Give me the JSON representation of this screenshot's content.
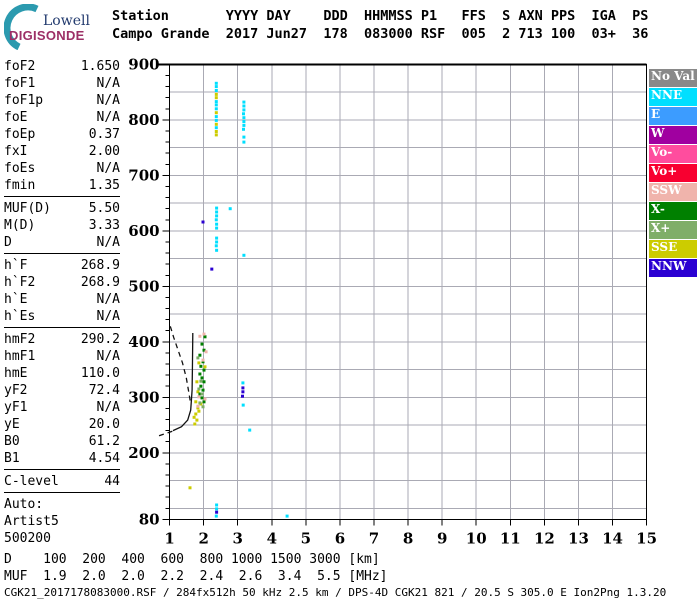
{
  "logo": {
    "line1": "Lowell",
    "line2": "DIGISONDE",
    "arc_color": "#2B9AAF",
    "line1_color": "#223A6E",
    "line2_color": "#9C2F66"
  },
  "header": {
    "row1": "Station       YYYY DAY    DDD  HHMMSS P1   FFS  S AXN PPS  IGA  PS",
    "row2": "Campo Grande  2017 Jun27  178  083000 RSF  005  2 713 100  03+  36"
  },
  "params": {
    "groups": [
      {
        "rows": [
          {
            "label": "foF2",
            "value": "1.650"
          },
          {
            "label": "foF1",
            "value": "N/A"
          },
          {
            "label": "foF1p",
            "value": "N/A"
          },
          {
            "label": "foE",
            "value": "N/A"
          },
          {
            "label": "foEp",
            "value": "0.37"
          },
          {
            "label": "fxI",
            "value": "2.00"
          },
          {
            "label": "foEs",
            "value": "N/A"
          },
          {
            "label": "fmin",
            "value": "1.35"
          }
        ],
        "rule": true
      },
      {
        "rows": [
          {
            "label": "MUF(D)",
            "value": "5.50"
          },
          {
            "label": "M(D)",
            "value": "3.33"
          },
          {
            "label": "D",
            "value": "N/A"
          }
        ],
        "rule": true
      },
      {
        "rows": [
          {
            "label": "h`F",
            "value": "268.9"
          },
          {
            "label": "h`F2",
            "value": "268.9"
          },
          {
            "label": "h`E",
            "value": "N/A"
          },
          {
            "label": "h`Es",
            "value": "N/A"
          }
        ],
        "rule": true
      },
      {
        "rows": [
          {
            "label": "hmF2",
            "value": "290.2"
          },
          {
            "label": "hmF1",
            "value": "N/A"
          },
          {
            "label": "hmE",
            "value": "110.0"
          },
          {
            "label": "yF2",
            "value": "72.4"
          },
          {
            "label": "yF1",
            "value": "N/A"
          },
          {
            "label": "yE",
            "value": "20.0"
          },
          {
            "label": "B0",
            "value": "61.2"
          },
          {
            "label": "B1",
            "value": "4.54"
          }
        ],
        "rule": true
      },
      {
        "rows": [
          {
            "label": "C-level",
            "value": "44"
          }
        ],
        "rule": true
      }
    ],
    "extra": [
      "Auto:",
      "Artist5",
      "500200"
    ]
  },
  "legend": {
    "items": [
      {
        "label": "No Val",
        "color": "#898989"
      },
      {
        "label": "NNE",
        "color": "#00DFFF"
      },
      {
        "label": "E",
        "color": "#3C9CFF"
      },
      {
        "label": "W",
        "color": "#A000A0"
      },
      {
        "label": "Vo-",
        "color": "#FF4D9E"
      },
      {
        "label": "Vo+",
        "color": "#F80030"
      },
      {
        "label": "SSW",
        "color": "#F0B4AC"
      },
      {
        "label": "X-",
        "color": "#008000"
      },
      {
        "label": "X+",
        "color": "#7FAE68"
      },
      {
        "label": "SSE",
        "color": "#CCCC00"
      },
      {
        "label": "NNW",
        "color": "#2A00D2"
      }
    ]
  },
  "chart_data": {
    "type": "scatter",
    "title": "Ionogram: virtual height (km) vs frequency (MHz)",
    "xlabel": "MHz",
    "ylabel": "km",
    "xlim": [
      1,
      15
    ],
    "ylim": [
      80,
      900
    ],
    "x_ticks": [
      1,
      2,
      3,
      4,
      5,
      6,
      7,
      8,
      9,
      10,
      11,
      12,
      13,
      14,
      15
    ],
    "y_tick_labels": [
      900,
      800,
      700,
      600,
      500,
      400,
      300,
      200,
      80
    ],
    "grid": {
      "x_step_mhz": 1,
      "y_step_km": 50,
      "color": "#AAAAB4"
    },
    "series": [
      {
        "name": "NNE",
        "color": "#00DFFF",
        "points": [
          [
            2.37,
            866
          ],
          [
            2.37,
            860
          ],
          [
            2.37,
            853
          ],
          [
            2.37,
            833
          ],
          [
            2.37,
            827
          ],
          [
            2.37,
            820
          ],
          [
            2.37,
            806
          ],
          [
            2.37,
            799
          ],
          [
            2.37,
            786
          ],
          [
            3.18,
            832
          ],
          [
            3.18,
            825
          ],
          [
            3.18,
            818
          ],
          [
            3.17,
            811
          ],
          [
            3.18,
            804
          ],
          [
            3.18,
            797
          ],
          [
            3.18,
            790
          ],
          [
            3.17,
            783
          ],
          [
            3.18,
            769
          ],
          [
            3.18,
            760
          ],
          [
            2.38,
            641
          ],
          [
            2.38,
            634
          ],
          [
            2.38,
            627
          ],
          [
            2.37,
            620
          ],
          [
            2.38,
            612
          ],
          [
            2.38,
            605
          ],
          [
            2.38,
            587
          ],
          [
            2.38,
            580
          ],
          [
            2.37,
            573
          ],
          [
            2.38,
            565
          ],
          [
            2.78,
            640
          ],
          [
            3.18,
            556
          ],
          [
            3.15,
            326
          ],
          [
            3.16,
            286
          ],
          [
            3.35,
            241
          ],
          [
            4.45,
            86
          ],
          [
            2.38,
            106
          ],
          [
            2.38,
            99
          ],
          [
            2.37,
            86
          ]
        ]
      },
      {
        "name": "SSE",
        "color": "#CCCC00",
        "points": [
          [
            2.37,
            846
          ],
          [
            2.37,
            840
          ],
          [
            2.37,
            813
          ],
          [
            2.37,
            792
          ],
          [
            2.37,
            779
          ],
          [
            2.37,
            773
          ],
          [
            1.86,
            362
          ],
          [
            2.04,
            355
          ],
          [
            1.8,
            328
          ],
          [
            1.83,
            310
          ],
          [
            1.77,
            292
          ],
          [
            1.92,
            288
          ],
          [
            1.83,
            281
          ],
          [
            1.86,
            275
          ],
          [
            1.77,
            270
          ],
          [
            1.72,
            264
          ],
          [
            1.8,
            259
          ],
          [
            1.74,
            252
          ],
          [
            1.6,
            137
          ]
        ]
      },
      {
        "name": "X-",
        "color": "#008000",
        "points": [
          [
            2.04,
            409
          ],
          [
            1.95,
            396
          ],
          [
            2.01,
            385
          ],
          [
            1.89,
            376
          ],
          [
            1.98,
            364
          ],
          [
            1.92,
            356
          ],
          [
            2.01,
            349
          ],
          [
            1.89,
            342
          ],
          [
            1.95,
            335
          ],
          [
            2.01,
            328
          ],
          [
            1.92,
            320
          ],
          [
            1.98,
            313
          ],
          [
            1.89,
            306
          ],
          [
            1.95,
            299
          ],
          [
            2.01,
            292
          ]
        ]
      },
      {
        "name": "X+",
        "color": "#7FAE68",
        "points": [
          [
            1.83,
            371
          ],
          [
            1.92,
            329
          ],
          [
            1.86,
            315
          ],
          [
            1.95,
            306
          ],
          [
            1.89,
            290
          ],
          [
            1.98,
            283
          ]
        ]
      },
      {
        "name": "SSW",
        "color": "#F0B4AC",
        "points": [
          [
            2.01,
            414
          ],
          [
            1.89,
            410
          ],
          [
            2.07,
            382
          ],
          [
            1.98,
            367
          ],
          [
            1.86,
            301
          ],
          [
            2.04,
            297
          ],
          [
            1.83,
            284
          ]
        ]
      },
      {
        "name": "NNW",
        "color": "#2A00D2",
        "points": [
          [
            1.98,
            616
          ],
          [
            2.24,
            531
          ],
          [
            3.15,
            317
          ],
          [
            3.15,
            310
          ],
          [
            3.14,
            302
          ],
          [
            2.38,
            93
          ]
        ]
      }
    ],
    "curves": [
      {
        "name": "profile-solid",
        "style": "solid",
        "points": [
          [
            1.68,
            416
          ],
          [
            1.67,
            350
          ],
          [
            1.66,
            313
          ],
          [
            1.62,
            277
          ],
          [
            1.53,
            259
          ],
          [
            1.35,
            247
          ],
          [
            1.1,
            240
          ]
        ]
      },
      {
        "name": "topside-dashed",
        "style": "dashed",
        "points": [
          [
            1.02,
            428
          ],
          [
            1.12,
            408
          ],
          [
            1.25,
            385
          ],
          [
            1.38,
            362
          ],
          [
            1.49,
            335
          ],
          [
            1.57,
            307
          ],
          [
            1.62,
            288
          ]
        ]
      },
      {
        "name": "tail-dashed",
        "style": "dashed",
        "points": [
          [
            1.08,
            239
          ],
          [
            0.85,
            234
          ],
          [
            0.6,
            229
          ]
        ]
      }
    ]
  },
  "footer": {
    "d_row": "D    100  200  400  600  800 1000 1500 3000 [km]",
    "muf_row": "MUF  1.9  2.0  2.0  2.2  2.4  2.6  3.4  5.5 [MHz]",
    "status": "CGK21_2017178083000.RSF / 284fx512h 50 kHz 2.5 km / DPS-4D CGK21 821 / 20.5 S 305.0 E Ion2Png 1.3.20"
  }
}
